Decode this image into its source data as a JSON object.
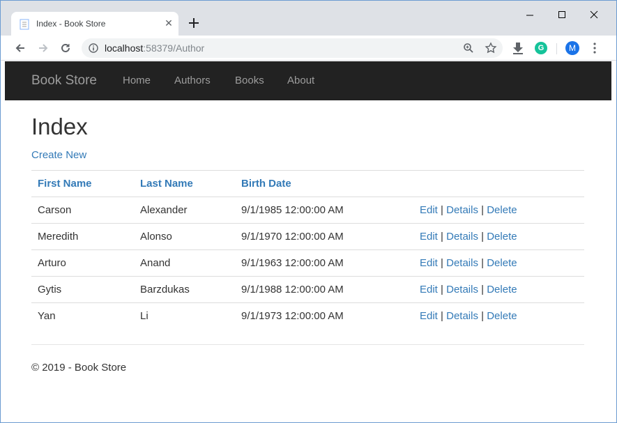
{
  "browser": {
    "tab_title": "Index - Book Store",
    "url_host": "localhost",
    "url_rest": ":58379/Author",
    "avatar_letter": "M",
    "ext_letter": "G"
  },
  "navbar": {
    "brand": "Book Store",
    "links": [
      "Home",
      "Authors",
      "Books",
      "About"
    ]
  },
  "page": {
    "title": "Index",
    "create_link": "Create New"
  },
  "table": {
    "headers": [
      "First Name",
      "Last Name",
      "Birth Date"
    ],
    "rows": [
      {
        "first": "Carson",
        "last": "Alexander",
        "birth": "9/1/1985 12:00:00 AM"
      },
      {
        "first": "Meredith",
        "last": "Alonso",
        "birth": "9/1/1970 12:00:00 AM"
      },
      {
        "first": "Arturo",
        "last": "Anand",
        "birth": "9/1/1963 12:00:00 AM"
      },
      {
        "first": "Gytis",
        "last": "Barzdukas",
        "birth": "9/1/1988 12:00:00 AM"
      },
      {
        "first": "Yan",
        "last": "Li",
        "birth": "9/1/1973 12:00:00 AM"
      }
    ],
    "actions": {
      "edit": "Edit",
      "details": "Details",
      "delete": "Delete",
      "separator": "|"
    }
  },
  "footer": {
    "text": "© 2019 - Book Store"
  },
  "colors": {
    "link": "#337ab7",
    "navbar_bg": "#222222",
    "navbar_text": "#9d9d9d"
  }
}
